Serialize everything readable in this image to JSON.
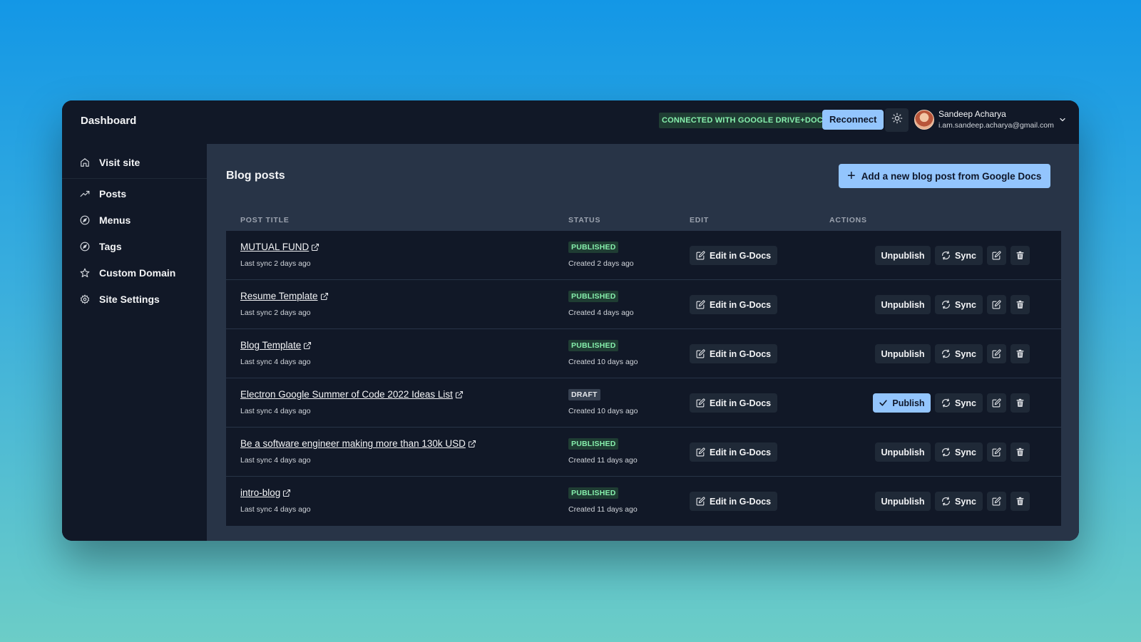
{
  "header": {
    "title": "Dashboard",
    "connection_status": "CONNECTED WITH GOOGLE DRIVE+DOCS",
    "reconnect_label": "Reconnect",
    "theme_icon": "sun-icon",
    "user": {
      "name": "Sandeep Acharya",
      "email": "i.am.sandeep.acharya@gmail.com"
    }
  },
  "sidebar": {
    "items": [
      {
        "label": "Visit site",
        "icon": "home-icon"
      },
      {
        "label": "Posts",
        "icon": "trending-up-icon"
      },
      {
        "label": "Menus",
        "icon": "compass-icon"
      },
      {
        "label": "Tags",
        "icon": "compass-icon"
      },
      {
        "label": "Custom Domain",
        "icon": "star-icon"
      },
      {
        "label": "Site Settings",
        "icon": "gear-icon"
      }
    ]
  },
  "main": {
    "title": "Blog posts",
    "add_button_label": "Add a new blog post from Google Docs",
    "columns": {
      "title": "POST TITLE",
      "status": "STATUS",
      "edit": "EDIT",
      "actions": "ACTIONS"
    },
    "edit_label": "Edit in G-Docs",
    "sync_label": "Sync",
    "posts": [
      {
        "title": "MUTUAL FUND",
        "last_sync": "Last sync 2 days ago",
        "status": "PUBLISHED",
        "created": "Created 2 days ago",
        "action": "Unpublish"
      },
      {
        "title": "Resume Template",
        "last_sync": "Last sync 2 days ago",
        "status": "PUBLISHED",
        "created": "Created 4 days ago",
        "action": "Unpublish"
      },
      {
        "title": "Blog Template",
        "last_sync": "Last sync 4 days ago",
        "status": "PUBLISHED",
        "created": "Created 10 days ago",
        "action": "Unpublish"
      },
      {
        "title": "Electron Google Summer of Code 2022 Ideas List",
        "last_sync": "Last sync 4 days ago",
        "status": "DRAFT",
        "created": "Created 10 days ago",
        "action": "Publish"
      },
      {
        "title": "Be a software engineer making more than 130k USD",
        "last_sync": "Last sync 4 days ago",
        "status": "PUBLISHED",
        "created": "Created 11 days ago",
        "action": "Unpublish"
      },
      {
        "title": "intro-blog",
        "last_sync": "Last sync 4 days ago",
        "status": "PUBLISHED",
        "created": "Created 11 days ago",
        "action": "Unpublish"
      }
    ]
  },
  "colors": {
    "accent": "#93c5fd",
    "published_badge_bg": "#1f3d33",
    "published_badge_text": "#86efac",
    "panel_bg": "#111827",
    "main_bg": "#283447"
  }
}
